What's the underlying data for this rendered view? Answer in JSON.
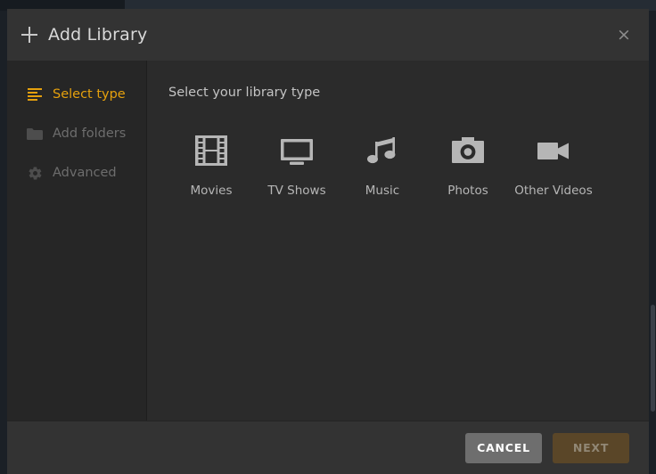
{
  "dialog": {
    "title": "Add Library",
    "add_icon": "plus-icon",
    "close_label": "×"
  },
  "sidebar": {
    "items": [
      {
        "label": "Select type",
        "icon": "list-icon",
        "state": "active"
      },
      {
        "label": "Add folders",
        "icon": "folder-icon",
        "state": "disabled"
      },
      {
        "label": "Advanced",
        "icon": "gear-icon",
        "state": "disabled"
      }
    ]
  },
  "content": {
    "heading": "Select your library type",
    "types": [
      {
        "label": "Movies",
        "icon": "film-strip-icon"
      },
      {
        "label": "TV Shows",
        "icon": "monitor-icon"
      },
      {
        "label": "Music",
        "icon": "music-note-icon"
      },
      {
        "label": "Photos",
        "icon": "camera-icon"
      },
      {
        "label": "Other Videos",
        "icon": "video-camera-icon"
      }
    ]
  },
  "footer": {
    "cancel_label": "CANCEL",
    "next_label": "NEXT"
  },
  "colors": {
    "accent": "#e5a00d",
    "dialog_bg": "#2b2b2b",
    "header_bg": "#333333",
    "sidebar_bg": "#262626",
    "cancel_bg": "#6e6e6e",
    "next_bg": "#5a4628",
    "next_text": "#918775",
    "icon_gray": "#b6b6b6"
  }
}
